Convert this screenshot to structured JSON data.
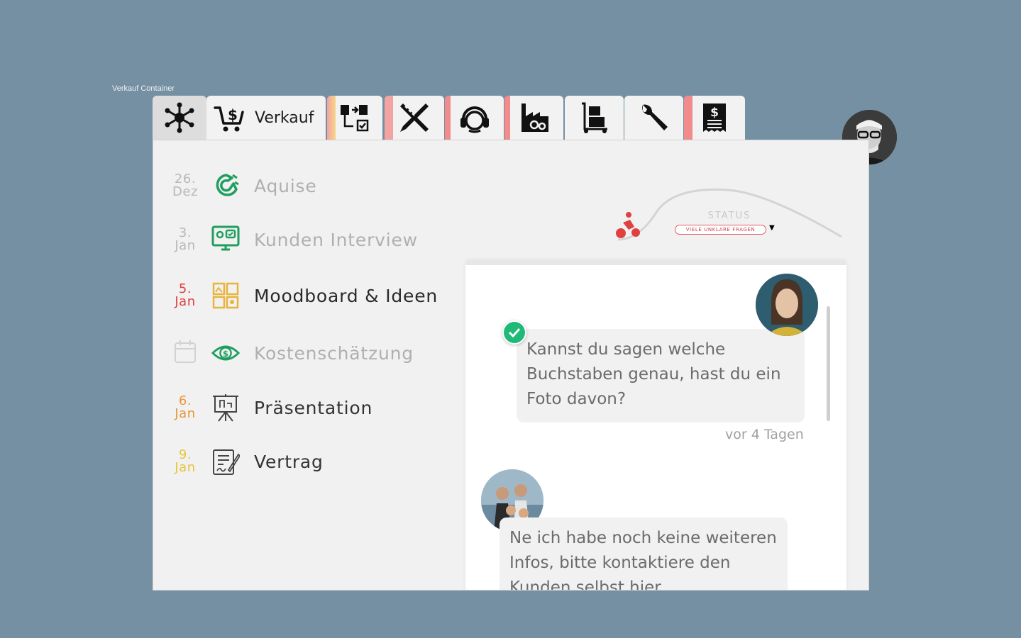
{
  "frame_label": "Verkauf Container",
  "colors": {
    "background": "#7590a2",
    "panel": "#f1f1f1",
    "green": "#1f9e60",
    "red": "#e04040",
    "orange": "#e8963a",
    "yellow": "#e8c43a",
    "pink_stripe": "#f28b8b"
  },
  "tabs": [
    {
      "icon": "hub-network-icon",
      "label": ""
    },
    {
      "icon": "shopping-cart-dollar-icon",
      "label": "Verkauf"
    },
    {
      "icon": "workflow-diagram-icon",
      "label": ""
    },
    {
      "icon": "pencil-ruler-icon",
      "label": ""
    },
    {
      "icon": "support-headset-icon",
      "label": ""
    },
    {
      "icon": "factory-gears-icon",
      "label": ""
    },
    {
      "icon": "hand-truck-icon",
      "label": ""
    },
    {
      "icon": "wrench-icon",
      "label": ""
    },
    {
      "icon": "invoice-dollar-icon",
      "label": ""
    }
  ],
  "steps": [
    {
      "day": "26.",
      "month": "Dez",
      "label": "Aquise",
      "icon": "magnet-icon",
      "state": "done"
    },
    {
      "day": "3.",
      "month": "Jan",
      "label": "Kunden Interview",
      "icon": "monitor-chat-icon",
      "state": "done"
    },
    {
      "day": "5.",
      "month": "Jan",
      "label": "Moodboard & Ideen",
      "icon": "moodboard-grid-icon",
      "state": "active"
    },
    {
      "day": "",
      "month": "",
      "label": "Kostenschätzung",
      "icon": "eye-dollar-icon",
      "state": "done"
    },
    {
      "day": "6.",
      "month": "Jan",
      "label": "Präsentation",
      "icon": "presentation-board-icon",
      "state": "upcoming"
    },
    {
      "day": "9.",
      "month": "Jan",
      "label": "Vertrag",
      "icon": "contract-signature-icon",
      "state": "upcoming"
    }
  ],
  "status": {
    "title": "STATUS",
    "value": "VIELE UNKLARE FRAGEN",
    "icon": "cyclist-icon"
  },
  "chat": {
    "messages": [
      {
        "text_lines": [
          "Kannst du sagen welche",
          "Buchstaben genau, hast du ein",
          "Foto davon?"
        ],
        "time": "vor 4 Tagen",
        "avatar": "woman-avatar",
        "read": true
      },
      {
        "text_lines": [
          "Ne ich habe noch keine weiteren",
          "Infos, bitte kontaktiere den",
          "Kunden selbst hier"
        ],
        "avatar": "family-avatar"
      }
    ]
  }
}
